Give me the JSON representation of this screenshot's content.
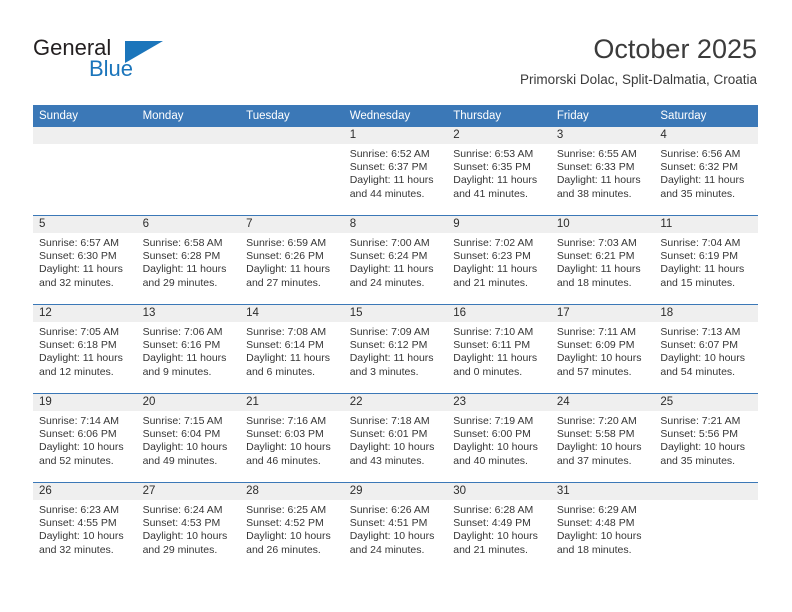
{
  "brand": {
    "word_one": "General",
    "word_two": "Blue",
    "triangle_icon": "triangle-icon",
    "accent_color": "#1b75bb"
  },
  "header": {
    "month_title": "October 2025",
    "location": "Primorski Dolac, Split-Dalmatia, Croatia"
  },
  "theme": {
    "header_blue": "#3b78b7",
    "daynum_band": "#efefef",
    "text": "#363636"
  },
  "weekday_headers": [
    "Sunday",
    "Monday",
    "Tuesday",
    "Wednesday",
    "Thursday",
    "Friday",
    "Saturday"
  ],
  "weeks": [
    [
      {
        "day": "",
        "sunrise": "",
        "sunset": "",
        "daylight_line1": "",
        "daylight_line2": ""
      },
      {
        "day": "",
        "sunrise": "",
        "sunset": "",
        "daylight_line1": "",
        "daylight_line2": ""
      },
      {
        "day": "",
        "sunrise": "",
        "sunset": "",
        "daylight_line1": "",
        "daylight_line2": ""
      },
      {
        "day": "1",
        "sunrise": "Sunrise: 6:52 AM",
        "sunset": "Sunset: 6:37 PM",
        "daylight_line1": "Daylight: 11 hours",
        "daylight_line2": "and 44 minutes."
      },
      {
        "day": "2",
        "sunrise": "Sunrise: 6:53 AM",
        "sunset": "Sunset: 6:35 PM",
        "daylight_line1": "Daylight: 11 hours",
        "daylight_line2": "and 41 minutes."
      },
      {
        "day": "3",
        "sunrise": "Sunrise: 6:55 AM",
        "sunset": "Sunset: 6:33 PM",
        "daylight_line1": "Daylight: 11 hours",
        "daylight_line2": "and 38 minutes."
      },
      {
        "day": "4",
        "sunrise": "Sunrise: 6:56 AM",
        "sunset": "Sunset: 6:32 PM",
        "daylight_line1": "Daylight: 11 hours",
        "daylight_line2": "and 35 minutes."
      }
    ],
    [
      {
        "day": "5",
        "sunrise": "Sunrise: 6:57 AM",
        "sunset": "Sunset: 6:30 PM",
        "daylight_line1": "Daylight: 11 hours",
        "daylight_line2": "and 32 minutes."
      },
      {
        "day": "6",
        "sunrise": "Sunrise: 6:58 AM",
        "sunset": "Sunset: 6:28 PM",
        "daylight_line1": "Daylight: 11 hours",
        "daylight_line2": "and 29 minutes."
      },
      {
        "day": "7",
        "sunrise": "Sunrise: 6:59 AM",
        "sunset": "Sunset: 6:26 PM",
        "daylight_line1": "Daylight: 11 hours",
        "daylight_line2": "and 27 minutes."
      },
      {
        "day": "8",
        "sunrise": "Sunrise: 7:00 AM",
        "sunset": "Sunset: 6:24 PM",
        "daylight_line1": "Daylight: 11 hours",
        "daylight_line2": "and 24 minutes."
      },
      {
        "day": "9",
        "sunrise": "Sunrise: 7:02 AM",
        "sunset": "Sunset: 6:23 PM",
        "daylight_line1": "Daylight: 11 hours",
        "daylight_line2": "and 21 minutes."
      },
      {
        "day": "10",
        "sunrise": "Sunrise: 7:03 AM",
        "sunset": "Sunset: 6:21 PM",
        "daylight_line1": "Daylight: 11 hours",
        "daylight_line2": "and 18 minutes."
      },
      {
        "day": "11",
        "sunrise": "Sunrise: 7:04 AM",
        "sunset": "Sunset: 6:19 PM",
        "daylight_line1": "Daylight: 11 hours",
        "daylight_line2": "and 15 minutes."
      }
    ],
    [
      {
        "day": "12",
        "sunrise": "Sunrise: 7:05 AM",
        "sunset": "Sunset: 6:18 PM",
        "daylight_line1": "Daylight: 11 hours",
        "daylight_line2": "and 12 minutes."
      },
      {
        "day": "13",
        "sunrise": "Sunrise: 7:06 AM",
        "sunset": "Sunset: 6:16 PM",
        "daylight_line1": "Daylight: 11 hours",
        "daylight_line2": "and 9 minutes."
      },
      {
        "day": "14",
        "sunrise": "Sunrise: 7:08 AM",
        "sunset": "Sunset: 6:14 PM",
        "daylight_line1": "Daylight: 11 hours",
        "daylight_line2": "and 6 minutes."
      },
      {
        "day": "15",
        "sunrise": "Sunrise: 7:09 AM",
        "sunset": "Sunset: 6:12 PM",
        "daylight_line1": "Daylight: 11 hours",
        "daylight_line2": "and 3 minutes."
      },
      {
        "day": "16",
        "sunrise": "Sunrise: 7:10 AM",
        "sunset": "Sunset: 6:11 PM",
        "daylight_line1": "Daylight: 11 hours",
        "daylight_line2": "and 0 minutes."
      },
      {
        "day": "17",
        "sunrise": "Sunrise: 7:11 AM",
        "sunset": "Sunset: 6:09 PM",
        "daylight_line1": "Daylight: 10 hours",
        "daylight_line2": "and 57 minutes."
      },
      {
        "day": "18",
        "sunrise": "Sunrise: 7:13 AM",
        "sunset": "Sunset: 6:07 PM",
        "daylight_line1": "Daylight: 10 hours",
        "daylight_line2": "and 54 minutes."
      }
    ],
    [
      {
        "day": "19",
        "sunrise": "Sunrise: 7:14 AM",
        "sunset": "Sunset: 6:06 PM",
        "daylight_line1": "Daylight: 10 hours",
        "daylight_line2": "and 52 minutes."
      },
      {
        "day": "20",
        "sunrise": "Sunrise: 7:15 AM",
        "sunset": "Sunset: 6:04 PM",
        "daylight_line1": "Daylight: 10 hours",
        "daylight_line2": "and 49 minutes."
      },
      {
        "day": "21",
        "sunrise": "Sunrise: 7:16 AM",
        "sunset": "Sunset: 6:03 PM",
        "daylight_line1": "Daylight: 10 hours",
        "daylight_line2": "and 46 minutes."
      },
      {
        "day": "22",
        "sunrise": "Sunrise: 7:18 AM",
        "sunset": "Sunset: 6:01 PM",
        "daylight_line1": "Daylight: 10 hours",
        "daylight_line2": "and 43 minutes."
      },
      {
        "day": "23",
        "sunrise": "Sunrise: 7:19 AM",
        "sunset": "Sunset: 6:00 PM",
        "daylight_line1": "Daylight: 10 hours",
        "daylight_line2": "and 40 minutes."
      },
      {
        "day": "24",
        "sunrise": "Sunrise: 7:20 AM",
        "sunset": "Sunset: 5:58 PM",
        "daylight_line1": "Daylight: 10 hours",
        "daylight_line2": "and 37 minutes."
      },
      {
        "day": "25",
        "sunrise": "Sunrise: 7:21 AM",
        "sunset": "Sunset: 5:56 PM",
        "daylight_line1": "Daylight: 10 hours",
        "daylight_line2": "and 35 minutes."
      }
    ],
    [
      {
        "day": "26",
        "sunrise": "Sunrise: 6:23 AM",
        "sunset": "Sunset: 4:55 PM",
        "daylight_line1": "Daylight: 10 hours",
        "daylight_line2": "and 32 minutes."
      },
      {
        "day": "27",
        "sunrise": "Sunrise: 6:24 AM",
        "sunset": "Sunset: 4:53 PM",
        "daylight_line1": "Daylight: 10 hours",
        "daylight_line2": "and 29 minutes."
      },
      {
        "day": "28",
        "sunrise": "Sunrise: 6:25 AM",
        "sunset": "Sunset: 4:52 PM",
        "daylight_line1": "Daylight: 10 hours",
        "daylight_line2": "and 26 minutes."
      },
      {
        "day": "29",
        "sunrise": "Sunrise: 6:26 AM",
        "sunset": "Sunset: 4:51 PM",
        "daylight_line1": "Daylight: 10 hours",
        "daylight_line2": "and 24 minutes."
      },
      {
        "day": "30",
        "sunrise": "Sunrise: 6:28 AM",
        "sunset": "Sunset: 4:49 PM",
        "daylight_line1": "Daylight: 10 hours",
        "daylight_line2": "and 21 minutes."
      },
      {
        "day": "31",
        "sunrise": "Sunrise: 6:29 AM",
        "sunset": "Sunset: 4:48 PM",
        "daylight_line1": "Daylight: 10 hours",
        "daylight_line2": "and 18 minutes."
      },
      {
        "day": "",
        "sunrise": "",
        "sunset": "",
        "daylight_line1": "",
        "daylight_line2": ""
      }
    ]
  ]
}
